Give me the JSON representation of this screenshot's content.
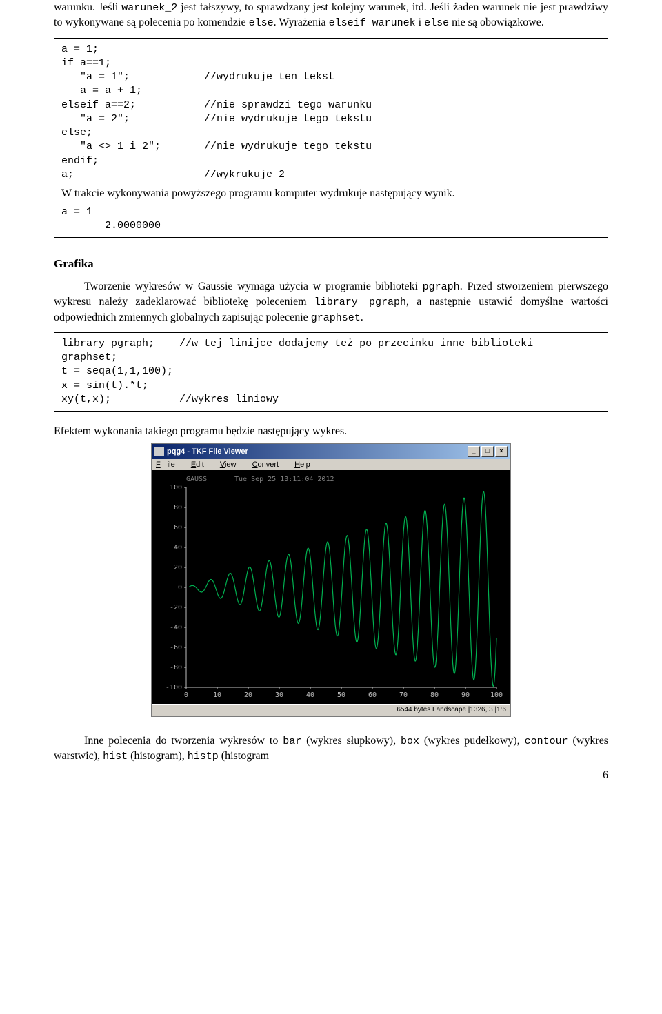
{
  "para1": {
    "t1": "warunku. Jeśli ",
    "code1": "warunek_2",
    "t2": " jest fałszywy, to sprawdzany jest kolejny warunek, itd. Jeśli żaden warunek nie jest prawdziwy to wykonywane są polecenia po komendzie ",
    "code2": "else",
    "t3": ". Wyrażenia ",
    "code3": "elseif warunek",
    "t4": " i ",
    "code4": "else",
    "t5": " nie są obowiązkowe."
  },
  "codebox1": {
    "l1": "a = 1;",
    "l2": "if a==1;",
    "l3": "   \"a = 1\";            //wydrukuje ten tekst",
    "l4": "   a = a + 1;",
    "l5": "elseif a==2;           //nie sprawdzi tego warunku",
    "l6": "   \"a = 2\";            //nie wydrukuje tego tekstu",
    "l7": "else;",
    "l8": "   \"a <> 1 i 2\";       //nie wydrukuje tego tekstu",
    "l9": "endif;",
    "l10": "a;                     //wykrukuje 2",
    "serif": "W trakcie wykonywania powyższego programu komputer wydrukuje następujący wynik.",
    "o1": "a = 1",
    "o2": "       2.0000000"
  },
  "heading_grafika": "Grafika",
  "para_grafika": {
    "t1": "Tworzenie wykresów w Gaussie wymaga użycia w programie biblioteki ",
    "c1": "pgraph",
    "t2": ". Przed stworzeniem pierwszego wykresu należy zadeklarować bibliotekę poleceniem ",
    "c2": "library pgraph",
    "t3": ", a następnie ustawić domyślne wartości odpowiednich zmiennych globalnych zapisując polecenie ",
    "c3": "graphset",
    "t4": "."
  },
  "codebox2": {
    "l1": "library pgraph;    //w tej linijce dodajemy też po przecinku inne biblioteki",
    "l2": "graphset;",
    "l3": "t = seqa(1,1,100);",
    "l4": "x = sin(t).*t;",
    "l5": "xy(t,x);           //wykres liniowy"
  },
  "para_efekt": "Efektem wykonania takiego programu będzie następujący wykres.",
  "viewer": {
    "title": "pqg4 - TKF File Viewer",
    "menu": {
      "file": "File",
      "edit": "Edit",
      "view": "View",
      "convert": "Convert",
      "help": "Help"
    },
    "header_left": "GAUSS",
    "header_right": "Tue Sep 25 13:11:04 2012",
    "y_ticks": [
      "100",
      "80",
      "60",
      "40",
      "20",
      "0",
      "-20",
      "-40",
      "-60",
      "-80",
      "-100"
    ],
    "x_ticks": [
      "0",
      "10",
      "20",
      "30",
      "40",
      "50",
      "60",
      "70",
      "80",
      "90",
      "100"
    ],
    "status": "6544 bytes Landscape |1326, 3 |1:6"
  },
  "chart_data": {
    "type": "line",
    "title": "",
    "xlabel": "",
    "ylabel": "",
    "xlim": [
      0,
      100
    ],
    "ylim": [
      -100,
      100
    ],
    "series": [
      {
        "name": "x = sin(t)·t",
        "formula": "sin(t)*t",
        "t_start": 1,
        "t_step": 1,
        "t_count": 100
      }
    ]
  },
  "para_inne": {
    "t1": "Inne polecenia do tworzenia wykresów to ",
    "c1": "bar",
    "t2": " (wykres słupkowy), ",
    "c2": "box",
    "t3": " (wykres pudełkowy), ",
    "c3": "contour",
    "t4": " (wykres warstwic), ",
    "c4": "hist",
    "t5": " (histogram), ",
    "c5": "histp",
    "t6": " (histogram"
  },
  "pagenum": "6"
}
